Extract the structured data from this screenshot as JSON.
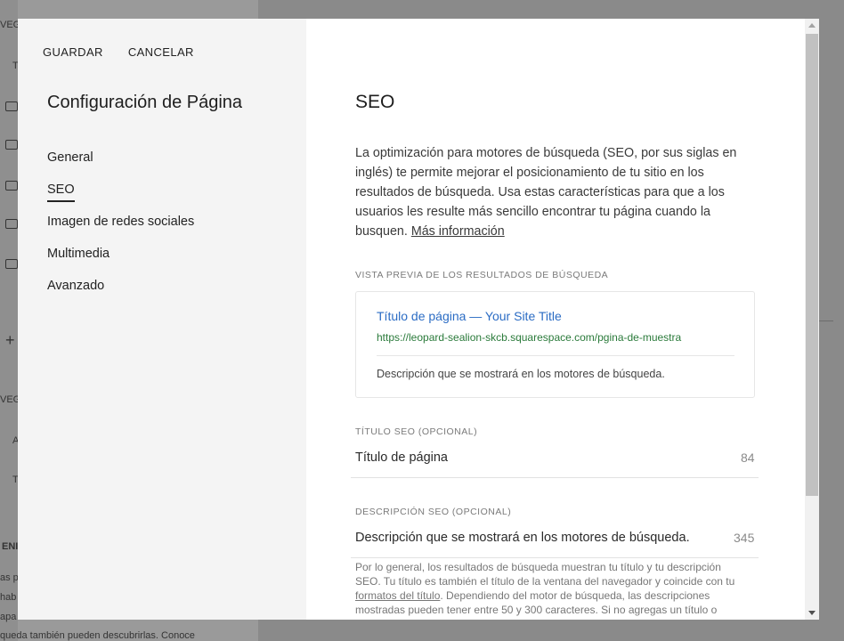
{
  "background": {
    "items": [
      "VEG",
      "T",
      "VEG",
      "A",
      "T",
      "ENI"
    ],
    "paragraph": [
      "as p",
      "hab",
      "apa",
      "queda también pueden descubrirlas. Conoce"
    ]
  },
  "modal": {
    "actions": {
      "save_label": "GUARDAR",
      "cancel_label": "CANCELAR"
    },
    "sidebar": {
      "title": "Configuración de Página",
      "items": [
        {
          "label": "General"
        },
        {
          "label": "SEO"
        },
        {
          "label": "Imagen de redes sociales"
        },
        {
          "label": "Multimedia"
        },
        {
          "label": "Avanzado"
        }
      ]
    },
    "seo": {
      "title": "SEO",
      "intro": "La optimización para motores de búsqueda (SEO, por sus siglas en inglés) te permite mejorar el posicionamiento de tu sitio en los resultados de búsqueda. Usa estas características para que a los usuarios les resulte más sencillo encontrar tu página cuando la busquen.",
      "more_info_link": "Más información",
      "preview_label": "VISTA PREVIA DE LOS RESULTADOS DE BÚSQUEDA",
      "preview": {
        "title": "Título de página — Your Site Title",
        "url": "https://leopard-sealion-skcb.squarespace.com/pgina-de-muestra",
        "description": "Descripción que se mostrará en los motores de búsqueda."
      },
      "seo_title_label": "TÍTULO SEO (OPCIONAL)",
      "seo_title_value": "Título de página",
      "seo_title_count": "84",
      "seo_desc_label": "DESCRIPCIÓN SEO (OPCIONAL)",
      "seo_desc_value": "Descripción que se mostrará en los motores de búsqueda.",
      "seo_desc_count": "345",
      "helper_before_link": "Por lo general, los resultados de búsqueda muestran tu título y tu descripción SEO. Tu título es también el título de la ventana del navegador y coincide con tu",
      "helper_link": "formatos del título",
      "helper_after_link": ". Dependiendo del motor de búsqueda, las descripciones mostradas pueden tener entre 50 y 300 caracteres. Si no agregas un título o"
    }
  },
  "colors": {
    "preview_title": "#2b6cc4",
    "preview_url": "#2a7a3a",
    "sidebar_bg": "#f4f4f4"
  }
}
